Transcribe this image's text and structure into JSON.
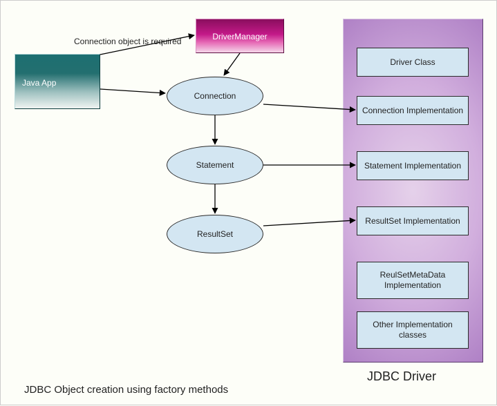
{
  "nodes": {
    "java_app": "Java App",
    "driver_manager": "DriverManager",
    "connection": "Connection",
    "statement": "Statement",
    "resultset": "ResultSet"
  },
  "labels": {
    "connection_required": "Connection object is required"
  },
  "driver_panel": {
    "caption": "JDBC Driver",
    "items": [
      "Driver Class",
      "Connection Implementation",
      "Statement Implementation",
      "ResultSet Implementation",
      "ReulSetMetaData Implementation",
      "Other Implementation classes"
    ]
  },
  "caption": "JDBC Object creation using factory methods"
}
